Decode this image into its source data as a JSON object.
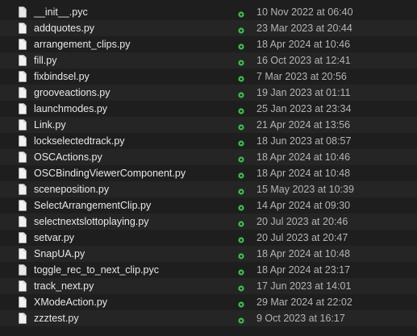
{
  "files": [
    {
      "name": "__init__.py​c",
      "date": "10 Nov 2022 at 06:40",
      "icon": "pyc-file-icon"
    },
    {
      "name": "addquotes.py",
      "date": "23 Mar 2023 at 20:44",
      "icon": "python-file-icon"
    },
    {
      "name": "arrangement_clips.py",
      "date": "18 Apr 2024 at 10:46",
      "icon": "python-file-icon"
    },
    {
      "name": "fill.py",
      "date": "16 Oct 2023 at 12:41",
      "icon": "python-file-icon"
    },
    {
      "name": "fixbindsel.py",
      "date": "7 Mar 2023 at 20:56",
      "icon": "python-file-icon"
    },
    {
      "name": "grooveactions.py",
      "date": "19 Jan 2023 at 01:11",
      "icon": "python-file-icon"
    },
    {
      "name": "launchmodes.py",
      "date": "25 Jan 2023 at 23:34",
      "icon": "python-file-icon"
    },
    {
      "name": "Link.py",
      "date": "21 Apr 2024 at 13:56",
      "icon": "python-file-icon"
    },
    {
      "name": "lockselectedtrack.py",
      "date": "18 Jun 2023 at 08:57",
      "icon": "python-file-icon"
    },
    {
      "name": "OSCActions.py",
      "date": "18 Apr 2024 at 10:46",
      "icon": "python-file-icon"
    },
    {
      "name": "OSCBindingViewerComponent.py",
      "date": "18 Apr 2024 at 10:48",
      "icon": "python-file-icon"
    },
    {
      "name": "sceneposition.py",
      "date": "15 May 2023 at 10:39",
      "icon": "python-file-icon"
    },
    {
      "name": "SelectArrangementClip.py",
      "date": "14 Apr 2024 at 09:30",
      "icon": "python-file-icon"
    },
    {
      "name": "selectnextslottoplaying.py",
      "date": "20 Jul 2023 at 20:46",
      "icon": "python-file-icon"
    },
    {
      "name": "setvar.py",
      "date": "20 Jul 2023 at 20:47",
      "icon": "python-file-icon"
    },
    {
      "name": "SnapUA.py",
      "date": "18 Apr 2024 at 10:48",
      "icon": "python-file-icon"
    },
    {
      "name": "toggle_rec_to_next_clip.pyc",
      "date": "18 Apr 2024 at 23:17",
      "icon": "pyc-file-icon"
    },
    {
      "name": "track_next.py",
      "date": "17 Jun 2023 at 14:01",
      "icon": "python-file-icon"
    },
    {
      "name": "XModeAction.py",
      "date": "29 Mar 2024 at 22:02",
      "icon": "python-file-icon"
    },
    {
      "name": "zzztest.py",
      "date": "9 Oct 2023 at 16:17",
      "icon": "python-file-icon"
    }
  ],
  "colors": {
    "background": "#1e1e1e",
    "row_alt": "#252525",
    "sync_status": "#3fb950",
    "file_name": "#e8e8e8",
    "date": "#b4b4b4"
  },
  "status_icon": "synced-checkmark-icon"
}
